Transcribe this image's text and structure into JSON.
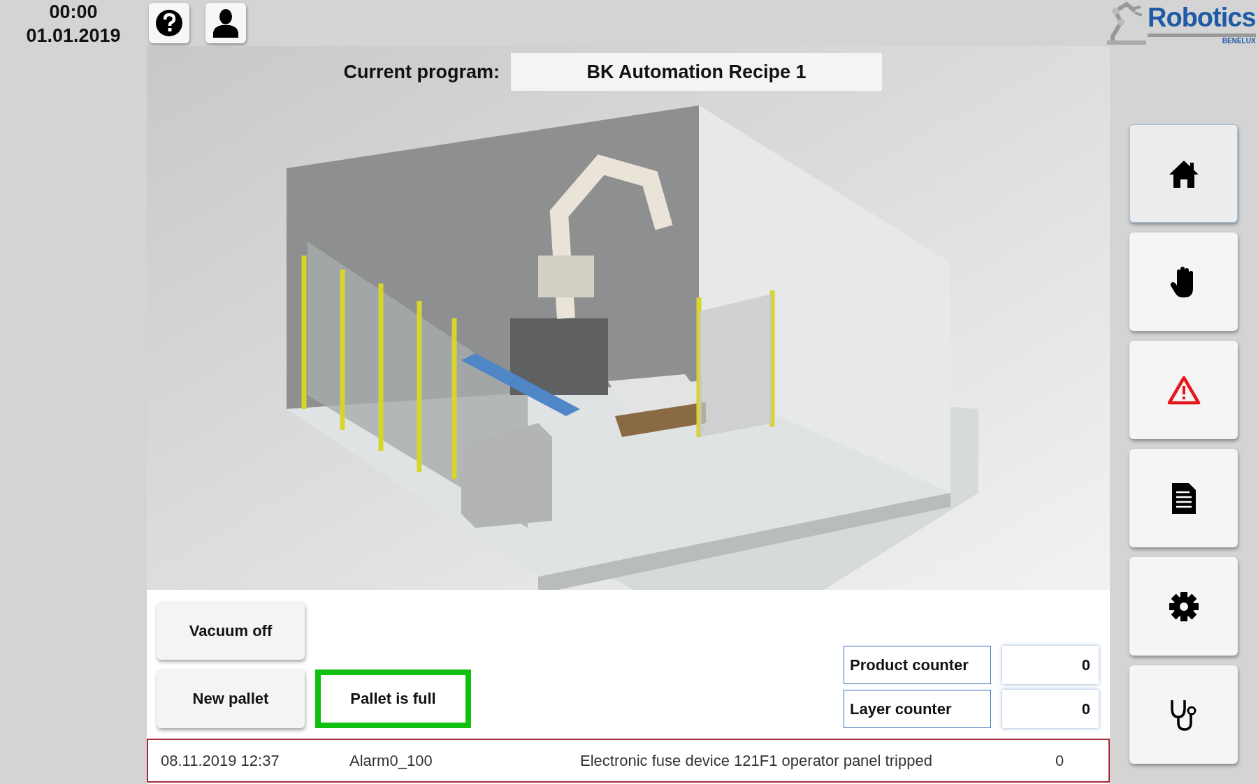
{
  "clock": {
    "time": "00:00",
    "date": "01.01.2019"
  },
  "logo": {
    "name": "Robotics",
    "sub": "BENELUX"
  },
  "program": {
    "label": "Current program:",
    "value": "BK Automation Recipe 1"
  },
  "buttons": [
    {
      "label": "Vacuum off"
    },
    {
      "label": "New pallet"
    }
  ],
  "indicator": {
    "label": "Pallet is full",
    "on": true
  },
  "counters": [
    {
      "label": "Product counter",
      "value": "0"
    },
    {
      "label": "Layer counter",
      "value": "0"
    }
  ],
  "alarm": {
    "time": "08.11.2019 12:37",
    "id": "Alarm0_100",
    "message": "Electronic fuse device 121F1 operator panel tripped",
    "count": "0"
  },
  "nav": [
    {
      "selected": true
    },
    {
      "selected": false
    },
    {
      "selected": false
    },
    {
      "selected": false
    },
    {
      "selected": false
    },
    {
      "selected": false
    }
  ]
}
